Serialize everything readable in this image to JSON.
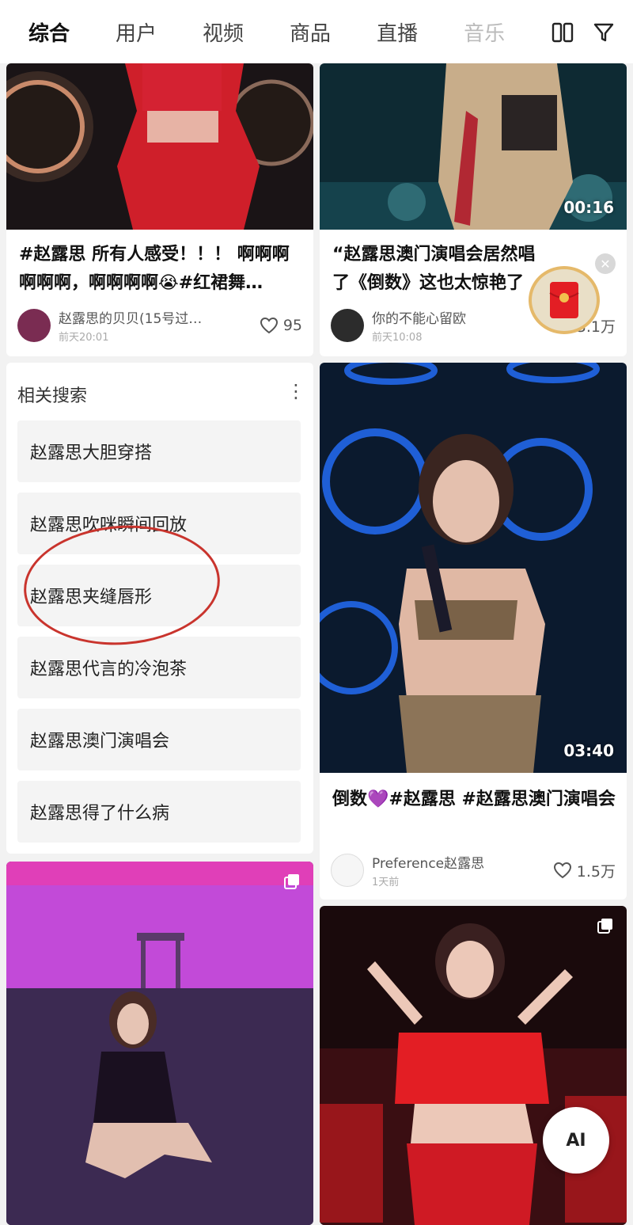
{
  "tabs": [
    {
      "label": "综合",
      "active": true
    },
    {
      "label": "用户"
    },
    {
      "label": "视频"
    },
    {
      "label": "商品"
    },
    {
      "label": "直播"
    },
    {
      "label": "音乐"
    }
  ],
  "top_icons": [
    "dual-column-icon",
    "filter-icon"
  ],
  "cards": {
    "c1": {
      "title": "#赵露思 所有人感受！！！ 啊啊啊啊啊啊，啊啊啊啊😭#红裙舞…",
      "author": "赵露思的贝贝(15号过…",
      "time": "前天20:01",
      "likes": "95"
    },
    "c2": {
      "duration": "00:16",
      "title": "“赵露思澳门演唱会居然唱了《倒数》这也太惊艳了吧！",
      "author": "你的不能心留欧",
      "time": "前天10:08",
      "likes": "3.1万"
    },
    "c3": {
      "duration": "03:40",
      "title": "倒数💜#赵露思 #赵露思澳门演唱会",
      "author": "Preference赵露思",
      "time": "1天前",
      "likes": "1.5万"
    }
  },
  "related": {
    "heading": "相关搜索",
    "items": [
      "赵露思大胆穿搭",
      "赵露思吹咪瞬间回放",
      "赵露思夹缝唇形",
      "赵露思代言的冷泡茶",
      "赵露思澳门演唱会",
      "赵露思得了什么病"
    ]
  },
  "floating": {
    "ai_label": "AI"
  },
  "colors": {
    "annotation_circle": "#c9342d",
    "stage_blue": "#1f5fd6",
    "accent_red": "#e31e24"
  }
}
